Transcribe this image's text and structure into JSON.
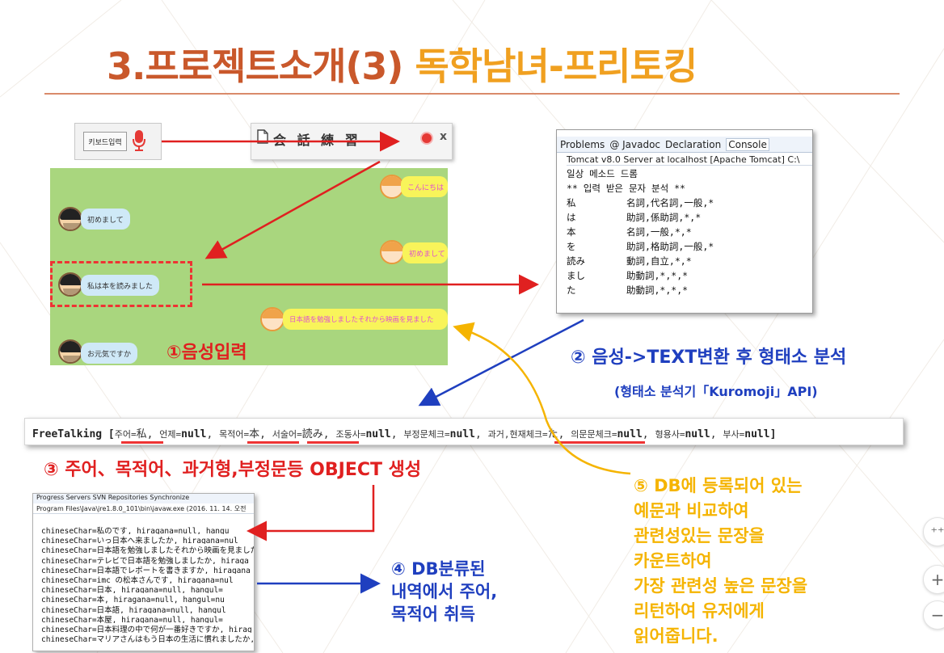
{
  "title": {
    "part1": "3.프로젝트소개(3)",
    "part2": "독학남녀-프리토킹"
  },
  "voice_ui": {
    "keyboard_button": "키보드입력",
    "window_title": "会 話 練 習",
    "close_label": "x"
  },
  "chat": {
    "messages": [
      {
        "side": "right",
        "text": "こんにちは"
      },
      {
        "side": "left",
        "text": "初めまして"
      },
      {
        "side": "right",
        "text": "初めまして"
      },
      {
        "side": "left",
        "text": "私は本を読みました"
      },
      {
        "side": "right",
        "text": "日本語を勉強しましたそれから映画を見ました"
      },
      {
        "side": "left",
        "text": "お元気ですか"
      }
    ],
    "step_label": "①음성입력"
  },
  "console": {
    "tabs": [
      "Problems",
      "@ Javadoc",
      "Declaration",
      "Console"
    ],
    "server_line": "Tomcat v8.0 Server at localhost [Apache Tomcat] C:\\",
    "line1": "일상 메소드 드롬",
    "line2": "** 입력 받은 문자 분석 **",
    "rows": [
      {
        "word": "私",
        "info": "名詞,代名詞,一般,*"
      },
      {
        "word": "は",
        "info": "助詞,係助詞,*,*"
      },
      {
        "word": "本",
        "info": "名詞,一般,*,*"
      },
      {
        "word": "を",
        "info": "助詞,格助詞,一般,*"
      },
      {
        "word": "読み",
        "info": "動詞,自立,*,*"
      },
      {
        "word": "まし",
        "info": "助動詞,*,*,*"
      },
      {
        "word": "た",
        "info": "助動詞,*,*,*"
      }
    ]
  },
  "step2": {
    "label": "② 음성->TEXT변환 후 형태소 분석",
    "sub": "(형태소 분석기「Kuromoji」API)"
  },
  "freetalk": {
    "prefix": "FreeTalking [",
    "parts": [
      {
        "key": "주어=",
        "val": "私"
      },
      {
        "key": "언제=",
        "val": "null"
      },
      {
        "key": "목적어=",
        "val": "本"
      },
      {
        "key": "서술어=",
        "val": "読み"
      },
      {
        "key": "조동사=",
        "val": "null"
      },
      {
        "key": "부정문체크=",
        "val": "null"
      },
      {
        "key": "과거,현재체크=",
        "val": "た"
      },
      {
        "key": "의문문체크=",
        "val": "null"
      },
      {
        "key": "형용사=",
        "val": "null"
      },
      {
        "key": "부사=",
        "val": "null]"
      }
    ]
  },
  "step3": {
    "label": "③ 주어、목적어、과거형,부정문등 OBJECT 생성"
  },
  "dblist": {
    "tabs": "Progress  Servers  SVN Repositories  Synchronize",
    "path": "Program Files\\Java\\jre1.8.0_101\\bin\\javaw.exe (2016. 11. 14. 오전",
    "lines": [
      "chineseChar=私のです, hiragana=null, hangu",
      "chineseChar=いっ日本へ来ましたか, hiragana=nul",
      "chineseChar=日本語を勉強しましたそれから映画を見ました,",
      "chineseChar=テレビで日本語を勉強しましたか, hiraga",
      "chineseChar=日本語でレポートを書きますか, hiragana",
      "chineseChar=imc の松本さんです, hiragana=nul",
      "chineseChar=日本, hiragana=null, hangul=",
      "chineseChar=本, hiragana=null, hangul=nu",
      "chineseChar=日本語, hiragana=null, hangul",
      "chineseChar=本屋, hiragana=null, hangul=",
      "chineseChar=日本料理の中で何が一番好きですか, hirag",
      "chineseChar=マリアさんはもう日本の生活に慣れましたか,"
    ]
  },
  "step4": {
    "lines": [
      "④ DB분류된",
      "내역에서 주어,",
      "목적어 취득"
    ]
  },
  "step5": {
    "lines": [
      "⑤ DB에 등록되어 있는",
      "예문과 비교하여",
      "관련성있는 문장을",
      "카운트하여",
      "가장 관련성 높은 문장을",
      "리턴하여 유저에게",
      "읽어줍니다."
    ]
  },
  "side_controls": {
    "fit": "⁺⁺",
    "zoom_in": "+",
    "zoom_out": "−"
  },
  "colors": {
    "title_red": "#c9582b",
    "title_orange": "#f0a020",
    "arrow_red": "#e02020",
    "arrow_blue": "#1f3fbf",
    "arrow_yellow": "#f5b400",
    "chat_bg": "#a9d67e"
  }
}
